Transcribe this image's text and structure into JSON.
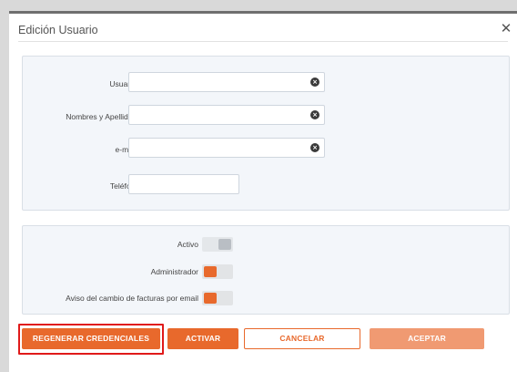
{
  "dialog": {
    "title": "Edición Usuario",
    "close_symbol": "✕"
  },
  "form": {
    "usuario": {
      "label": "Usuario*",
      "value": ""
    },
    "nombres": {
      "label": "Nombres y Apellidos*",
      "value": ""
    },
    "email": {
      "label": "e-mail*",
      "value": ""
    },
    "telefono": {
      "label": "Teléfono",
      "value": ""
    },
    "clear_symbol": "×"
  },
  "toggles": {
    "activo": {
      "label": "Activo",
      "on": false
    },
    "administrador": {
      "label": "Administrador",
      "on": true
    },
    "aviso": {
      "label": "Aviso del cambio de facturas por email",
      "on": true
    }
  },
  "buttons": {
    "regenerar": "REGENERAR CREDENCIALES",
    "activar": "ACTIVAR",
    "cancelar": "CANCELAR",
    "aceptar": "ACEPTAR"
  },
  "colors": {
    "accent": "#e8692c",
    "accent_disabled": "#f09a72",
    "highlight": "#e01a1a"
  }
}
